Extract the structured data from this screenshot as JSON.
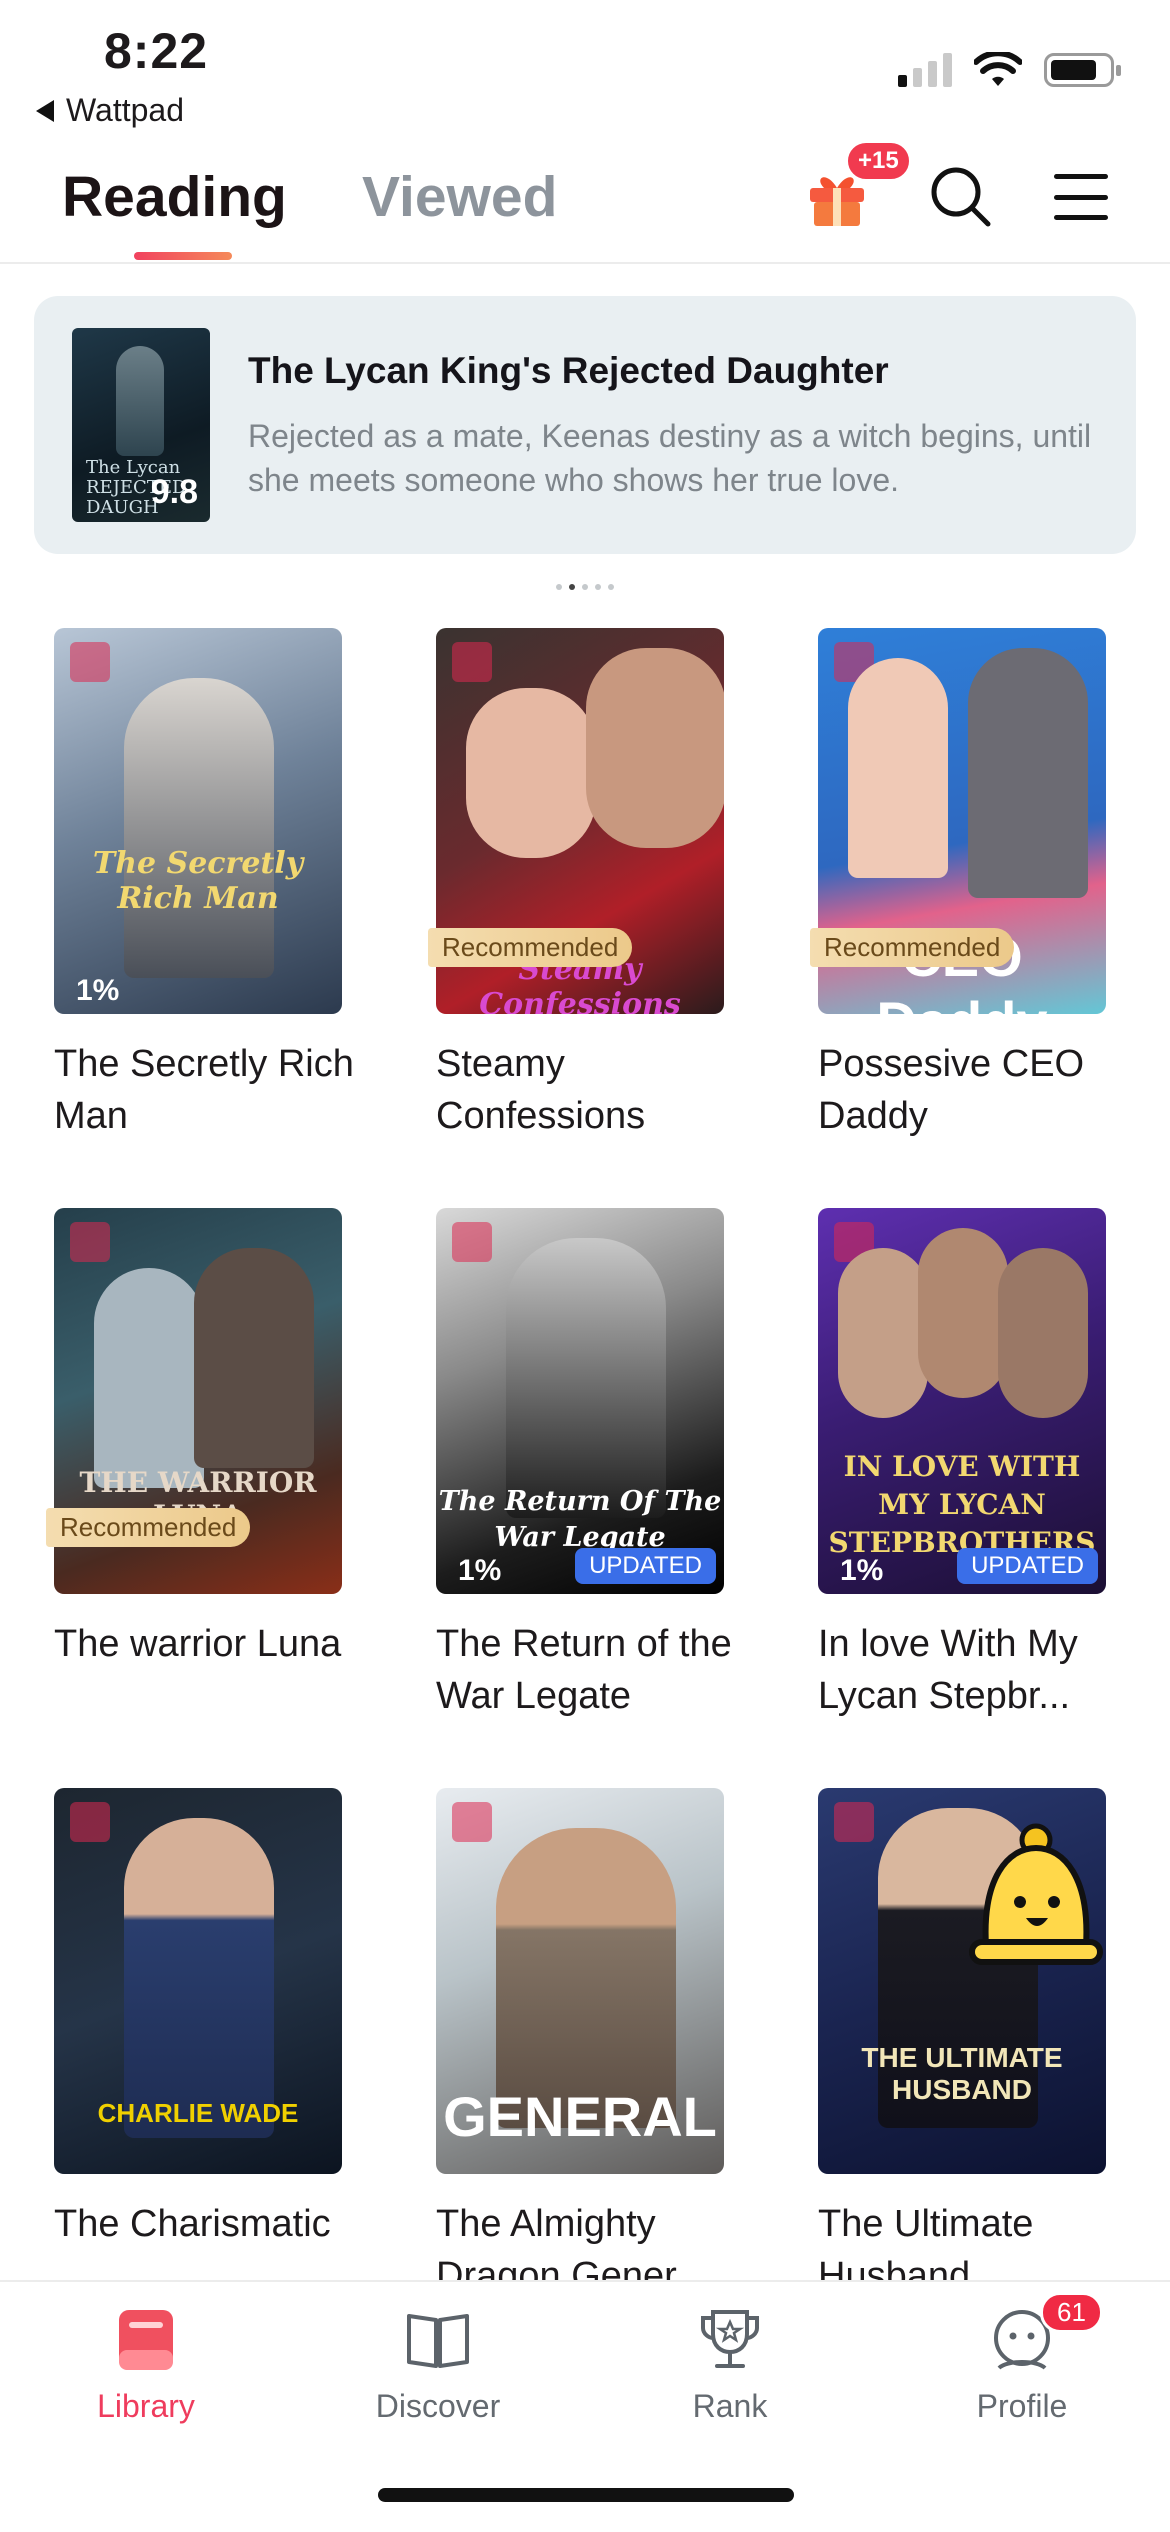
{
  "status": {
    "time": "8:22",
    "back_app": "Wattpad"
  },
  "header": {
    "tab_reading": "Reading",
    "tab_viewed": "Viewed",
    "gift_badge": "+15"
  },
  "banner": {
    "title": "The Lycan King's Rejected Daughter",
    "description": "Rejected as a mate, Keenas destiny as a witch begins, until she meets someone who shows her true love.",
    "rating": "9.8"
  },
  "books": [
    {
      "title": "The Secretly Rich Man",
      "progress": "1%",
      "badge": "",
      "cover_text": "The Secretly Rich Man"
    },
    {
      "title": "Steamy Confessions",
      "progress": "",
      "badge": "Recommended",
      "cover_text": "Steamy Confessions"
    },
    {
      "title": "Possesive CEO Daddy",
      "progress": "",
      "badge": "Recommended",
      "cover_text": "CEO Daddy"
    },
    {
      "title": "The warrior Luna",
      "progress": "",
      "badge": "Recommended",
      "cover_text": "THE WARRIOR LUNA"
    },
    {
      "title": "The Return of the War Legate",
      "progress": "1%",
      "badge": "UPDATED",
      "cover_text": "The Return Of The War Legate"
    },
    {
      "title": "In love With My Lycan Stepbr...",
      "progress": "1%",
      "badge": "UPDATED",
      "cover_text": "IN LOVE WITH MY LYCAN STEPBROTHERS"
    },
    {
      "title": "The Charismatic",
      "progress": "",
      "badge": "",
      "cover_text": "CHARLIE WADE"
    },
    {
      "title": "The Almighty Dragon Gener",
      "progress": "",
      "badge": "",
      "cover_text": "GENERAL"
    },
    {
      "title": "The Ultimate Husband",
      "progress": "",
      "badge": "",
      "cover_text": "THE ULTIMATE HUSBAND"
    }
  ],
  "nav": {
    "library": "Library",
    "discover": "Discover",
    "rank": "Rank",
    "profile": "Profile",
    "profile_badge": "61"
  },
  "colors": {
    "accent": "#ef3c5d",
    "updated_badge": "#3a6ee8",
    "recommended_badge": "#ecc98a"
  }
}
